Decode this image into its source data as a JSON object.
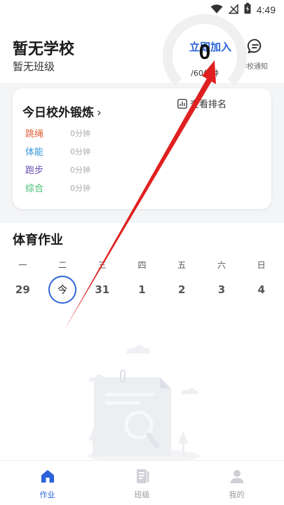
{
  "status_bar": {
    "time": "4:49",
    "icons": [
      "wifi-icon",
      "no-signal-icon",
      "battery-icon"
    ]
  },
  "header": {
    "school": "暂无学校",
    "class": "暂无班级",
    "join_label": "立即加入",
    "notice_label": "学校通知"
  },
  "exercise_card": {
    "title": "今日校外锻炼",
    "chevron": "›",
    "metrics": [
      {
        "label": "跳绳",
        "value": "0分钟",
        "color": "#e2613a"
      },
      {
        "label": "体能",
        "value": "0分钟",
        "color": "#3596d8"
      },
      {
        "label": "跑步",
        "value": "0分钟",
        "color": "#6a4fb3"
      },
      {
        "label": "综合",
        "value": "0分钟",
        "color": "#3fbf6d"
      }
    ],
    "progress": {
      "current": "0",
      "goal_label": "/60分钟",
      "fraction": 0
    },
    "rank_label": "查看排名"
  },
  "pe_homework": {
    "title": "体育作业",
    "weekdays": [
      "一",
      "二",
      "三",
      "四",
      "五",
      "六",
      "日"
    ],
    "dates": [
      "29",
      "今",
      "31",
      "1",
      "2",
      "3",
      "4"
    ],
    "selected_index": 1
  },
  "tabbar": {
    "tabs": [
      {
        "label": "作业",
        "icon": "home-icon",
        "active": true
      },
      {
        "label": "班级",
        "icon": "class-icon",
        "active": false
      },
      {
        "label": "我的",
        "icon": "profile-icon",
        "active": false
      }
    ],
    "accent": "#2a63d8"
  }
}
